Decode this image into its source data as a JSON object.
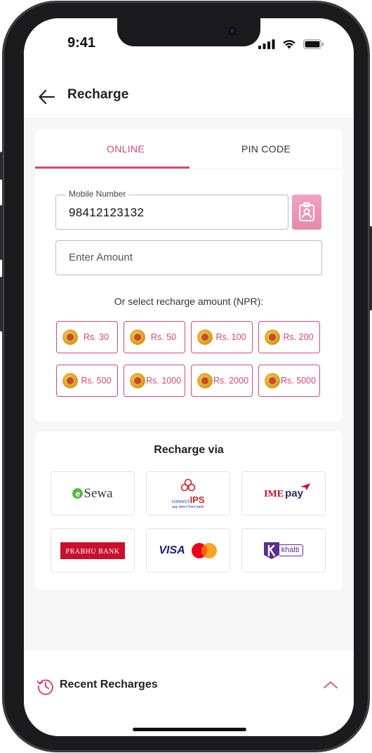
{
  "status_bar": {
    "time": "9:41"
  },
  "header": {
    "title": "Recharge"
  },
  "tabs": [
    {
      "label": "ONLINE",
      "active": true
    },
    {
      "label": "PIN CODE",
      "active": false
    }
  ],
  "form": {
    "mobile_label": "Mobile Number",
    "mobile_value": "98412123132",
    "amount_placeholder": "Enter Amount",
    "hint": "Or select recharge amount (NPR):"
  },
  "amounts": [
    "Rs. 30",
    "Rs. 50",
    "Rs. 100",
    "Rs. 200",
    "Rs. 500",
    "Rs. 1000",
    "Rs. 2000",
    "Rs. 5000"
  ],
  "recharge_via": {
    "title": "Recharge via",
    "methods": [
      {
        "icon": "esewa-logo",
        "text": "Sewa"
      },
      {
        "icon": "connectips-logo",
        "text": "IPS",
        "brand": "connect",
        "tagline": "pay direct from bank"
      },
      {
        "icon": "imepay-logo",
        "text": "IME",
        "text2": "pay"
      },
      {
        "icon": "prabhu-bank-logo",
        "text": "PRABHU BANK"
      },
      {
        "icon": "visa-mastercard-logo",
        "text": "VISA"
      },
      {
        "icon": "khalti-logo",
        "text": "khalti"
      }
    ]
  },
  "recent": {
    "title": "Recent Recharges"
  },
  "colors": {
    "accent": "#d6487a",
    "accent_light": "#e58aab",
    "background": "#f6f6f7"
  }
}
